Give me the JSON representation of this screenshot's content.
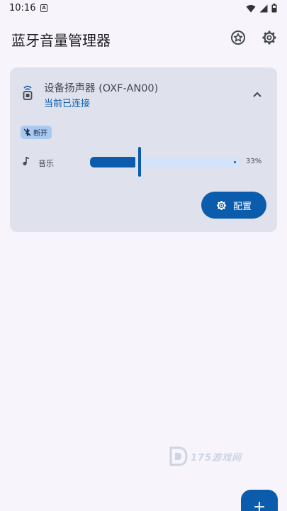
{
  "status_bar": {
    "time": "10:16",
    "notification_badge": "A"
  },
  "app_bar": {
    "title": "蓝牙音量管理器"
  },
  "device_card": {
    "name": "设备扬声器 (OXF-AN00)",
    "status": "当前已连接",
    "disconnect_chip_label": "断开",
    "volume": {
      "label": "音乐",
      "level_percent": 33,
      "display": "33%"
    },
    "config_button_label": "配置"
  },
  "watermark": {
    "text": "175游戏网"
  },
  "fab": {
    "label": "+"
  },
  "colors": {
    "accent": "#0b5cad",
    "card_bg": "#dfe2ec",
    "chip_bg": "#a9c8f2",
    "track_inactive": "#d3e3fa"
  }
}
